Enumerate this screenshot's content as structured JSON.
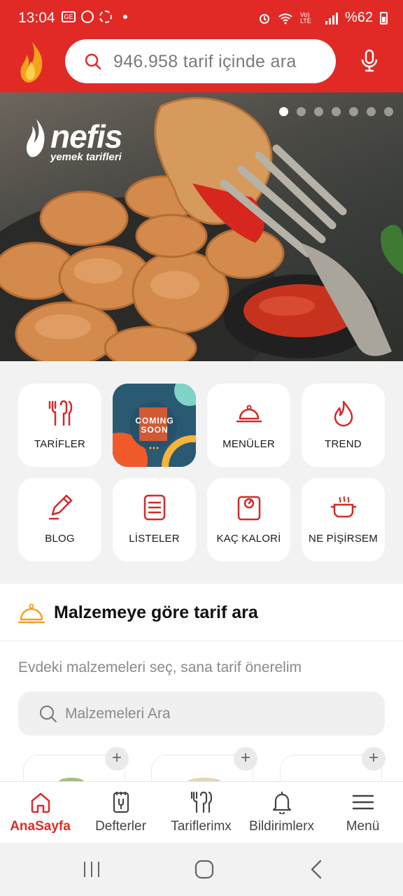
{
  "status_bar": {
    "time": "13:04",
    "battery": "%62",
    "network": "Vo) LTE"
  },
  "header": {
    "search_placeholder": "946.958 tarif içinde ara",
    "brand_color": "#e12a26"
  },
  "hero": {
    "brand_name": "nefis",
    "brand_sub": "yemek tarifleri",
    "slide_count": 7,
    "active_slide": 1
  },
  "categories": [
    {
      "label": "TARİFLER",
      "icon": "fork-knife-icon"
    },
    {
      "label": "COMING SOON",
      "icon": "coming-soon-banner"
    },
    {
      "label": "MENÜLER",
      "icon": "cloche-icon"
    },
    {
      "label": "TREND",
      "icon": "flame-icon"
    },
    {
      "label": "BLOG",
      "icon": "pencil-icon"
    },
    {
      "label": "LİSTELER",
      "icon": "list-icon"
    },
    {
      "label": "KAÇ KALORİ",
      "icon": "scale-icon"
    },
    {
      "label": "NE PİŞİRSEM",
      "icon": "pot-icon"
    }
  ],
  "coming_soon": {
    "line1": "COMING",
    "line2": "SOON"
  },
  "ingredients": {
    "title": "Malzemeye göre tarif ara",
    "subtitle": "Evdeki malzemeleri seç, sana tarif önerelim",
    "search_placeholder": "Malzemeleri Ara",
    "add_label": "+"
  },
  "bottom_nav": [
    {
      "label": "AnaSayfa",
      "icon": "home-icon",
      "active": true
    },
    {
      "label": "Defterler",
      "icon": "notebook-icon",
      "active": false
    },
    {
      "label": "Tariflerimx",
      "icon": "fork-knife-icon",
      "active": false
    },
    {
      "label": "Bildirimlerx",
      "icon": "bell-icon",
      "active": false
    },
    {
      "label": "Menü",
      "icon": "hamburger-icon",
      "active": false
    }
  ]
}
